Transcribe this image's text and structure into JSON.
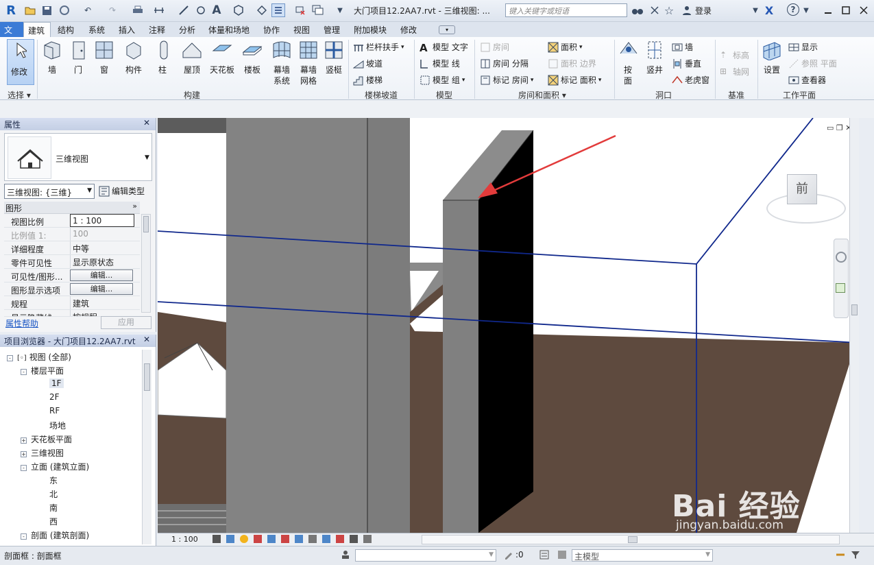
{
  "titlebar": {
    "doc_title": "大门项目12.2AA7.rvt - 三维视图: ...",
    "search_placeholder": "键入关键字或短语",
    "login": "登录",
    "help_glyph": "?"
  },
  "tabs": [
    "文件",
    "建筑",
    "结构",
    "系统",
    "插入",
    "注释",
    "分析",
    "体量和场地",
    "协作",
    "视图",
    "管理",
    "附加模块",
    "修改"
  ],
  "ribbon": {
    "modify": "修改",
    "select": "选择 ▾",
    "build_buttons": [
      "墙",
      "门",
      "窗",
      "构件",
      "柱",
      "屋顶",
      "天花板",
      "楼板",
      "幕墙\n系统",
      "幕墙\n网格",
      "竖梃"
    ],
    "build_group": "构建",
    "stairs": [
      "栏杆扶手",
      "坡道",
      "楼梯"
    ],
    "stairs_group": "楼梯坡道",
    "model": [
      "模型 文字",
      "模型 线",
      "模型 组"
    ],
    "model_group": "模型",
    "room_col1": [
      "房间",
      "房间 分隔",
      "标记 房间"
    ],
    "room_col2": [
      "面积",
      "面积 边界",
      "标记 面积"
    ],
    "room_group": "房间和面积 ▾",
    "opening": [
      "按\n面",
      "竖井"
    ],
    "opening_small": [
      "墙",
      "垂直",
      "老虎窗"
    ],
    "opening_group": "洞口",
    "datum": [
      "标高",
      "轴网"
    ],
    "datum_group": "基准",
    "workplane": [
      "设置"
    ],
    "workplane_small": [
      "显示",
      "参照 平面",
      "查看器"
    ],
    "workplane_group": "工作平面"
  },
  "properties": {
    "title": "属性",
    "type_name": "三维视图",
    "view_type": "三维视图: {三维}",
    "edit_type": "编辑类型",
    "section": "图形",
    "rows": [
      {
        "k": "视图比例",
        "v": "1 : 100"
      },
      {
        "k": "比例值 1:",
        "v": "100"
      },
      {
        "k": "详细程度",
        "v": "中等"
      },
      {
        "k": "零件可见性",
        "v": "显示原状态"
      },
      {
        "k": "可见性/图形...",
        "v": "编辑..."
      },
      {
        "k": "图形显示选项",
        "v": "编辑..."
      },
      {
        "k": "规程",
        "v": "建筑"
      },
      {
        "k": "显示隐藏线",
        "v": "按规程"
      }
    ],
    "help": "属性帮助",
    "apply": "应用"
  },
  "browser": {
    "title": "项目浏览器 - 大门项目12.2AA7.rvt",
    "tree": [
      {
        "t": "视图 (全部)",
        "lvl": 0,
        "pm": "-"
      },
      {
        "t": "楼层平面",
        "lvl": 1,
        "pm": "-"
      },
      {
        "t": "1F",
        "lvl": 2,
        "pm": ""
      },
      {
        "t": "2F",
        "lvl": 2,
        "pm": ""
      },
      {
        "t": "RF",
        "lvl": 2,
        "pm": ""
      },
      {
        "t": "场地",
        "lvl": 2,
        "pm": ""
      },
      {
        "t": "天花板平面",
        "lvl": 1,
        "pm": "+"
      },
      {
        "t": "三维视图",
        "lvl": 1,
        "pm": "+"
      },
      {
        "t": "立面 (建筑立面)",
        "lvl": 1,
        "pm": "-"
      },
      {
        "t": "东",
        "lvl": 2,
        "pm": ""
      },
      {
        "t": "北",
        "lvl": 2,
        "pm": ""
      },
      {
        "t": "南",
        "lvl": 2,
        "pm": ""
      },
      {
        "t": "西",
        "lvl": 2,
        "pm": ""
      },
      {
        "t": "剖面 (建筑剖面)",
        "lvl": 1,
        "pm": "-"
      }
    ]
  },
  "viewport": {
    "viewcube_label": "前",
    "watermark": "Bai 经验",
    "watermark_url": "jingyan.baidu.com"
  },
  "viewbar": {
    "scale": "1 : 100"
  },
  "status": {
    "left": "剖面框 : 剖面框",
    "zero": ":0",
    "model": "主模型"
  },
  "colors": {
    "accent": "#3b7bd6",
    "ground": "#5e4a3e",
    "wall": "#808080",
    "box_line": "#10288c",
    "arrow": "#e23b3b"
  }
}
